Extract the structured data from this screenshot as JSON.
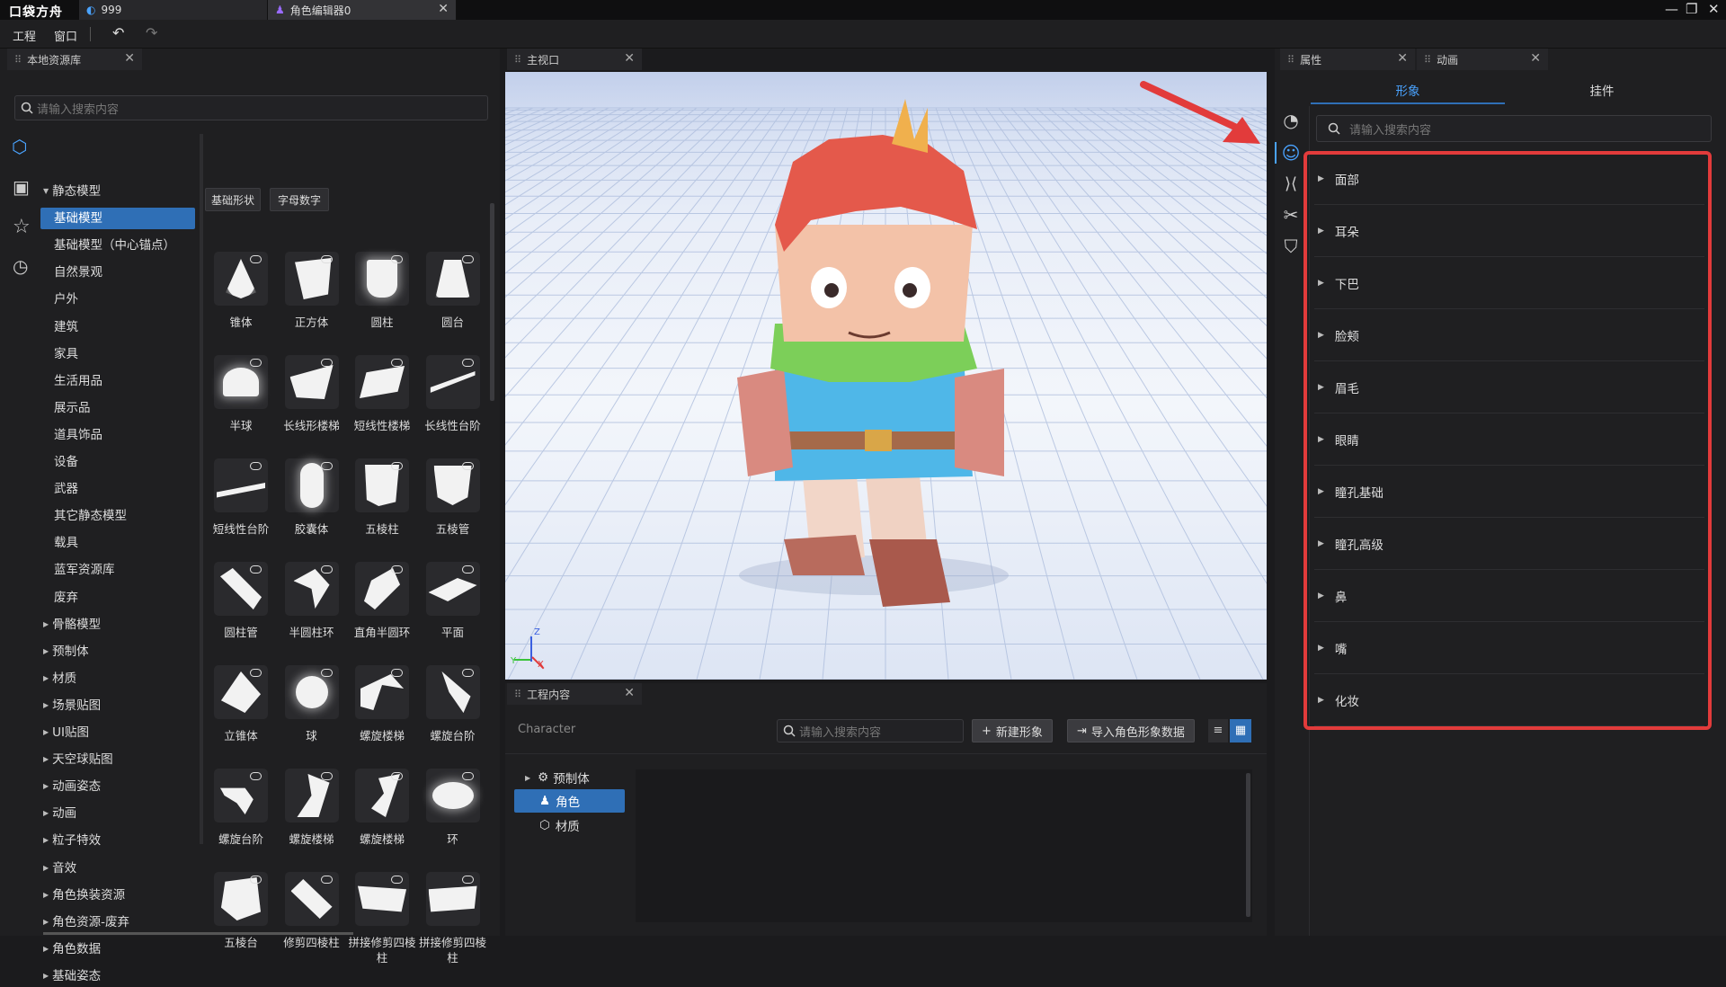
{
  "app": {
    "logo": "口袋方舟"
  },
  "tabs": [
    {
      "label": "999"
    },
    {
      "label": "角色编辑器0"
    }
  ],
  "menu": {
    "project": "工程",
    "window": "窗口"
  },
  "left_panel": {
    "tab_label": "本地资源库",
    "search_placeholder": "请输入搜索内容",
    "categories": [
      {
        "label": "静态模型",
        "expanded": true
      },
      {
        "label": "基础模型",
        "selected": true
      },
      {
        "label": "基础模型（中心锚点）"
      },
      {
        "label": "自然景观"
      },
      {
        "label": "户外"
      },
      {
        "label": "建筑"
      },
      {
        "label": "家具"
      },
      {
        "label": "生活用品"
      },
      {
        "label": "展示品"
      },
      {
        "label": "道具饰品"
      },
      {
        "label": "设备"
      },
      {
        "label": "武器"
      },
      {
        "label": "其它静态模型"
      },
      {
        "label": "载具"
      },
      {
        "label": "蓝军资源库"
      },
      {
        "label": "废弃"
      },
      {
        "label": "骨骼模型"
      },
      {
        "label": "预制体"
      },
      {
        "label": "材质"
      },
      {
        "label": "场景贴图"
      },
      {
        "label": "UI贴图"
      },
      {
        "label": "天空球贴图"
      },
      {
        "label": "动画姿态"
      },
      {
        "label": "动画"
      },
      {
        "label": "粒子特效"
      },
      {
        "label": "音效"
      },
      {
        "label": "角色换装资源"
      },
      {
        "label": "角色资源-废弃"
      },
      {
        "label": "角色数据"
      },
      {
        "label": "基础姿态"
      }
    ],
    "chips": [
      "基础形状",
      "字母数字"
    ],
    "assets": [
      {
        "label": "锥体",
        "icon": "cone-shape"
      },
      {
        "label": "正方体",
        "icon": "cube-shape"
      },
      {
        "label": "圆柱",
        "icon": "cylinder-shape"
      },
      {
        "label": "圆台",
        "icon": "frustum-shape"
      },
      {
        "label": "半球",
        "icon": "hemisphere-shape"
      },
      {
        "label": "长线形楼梯",
        "icon": "long-stairs-shape"
      },
      {
        "label": "短线性楼梯",
        "icon": "short-stairs-shape"
      },
      {
        "label": "长线性台阶",
        "icon": "long-step-shape"
      },
      {
        "label": "短线性台阶",
        "icon": "short-step-shape"
      },
      {
        "label": "胶囊体",
        "icon": "capsule-shape"
      },
      {
        "label": "五棱柱",
        "icon": "pentagonal-prism-shape"
      },
      {
        "label": "五棱管",
        "icon": "pentagonal-tube-shape"
      },
      {
        "label": "圆柱管",
        "icon": "cylinder-tube-shape"
      },
      {
        "label": "半圆柱环",
        "icon": "half-ring-shape"
      },
      {
        "label": "直角半圆环",
        "icon": "right-angle-ring-shape"
      },
      {
        "label": "平面",
        "icon": "plane-shape"
      },
      {
        "label": "立锥体",
        "icon": "pyramid-shape"
      },
      {
        "label": "球",
        "icon": "sphere-shape"
      },
      {
        "label": "螺旋楼梯",
        "icon": "spiral-stairs-shape"
      },
      {
        "label": "螺旋台阶",
        "icon": "spiral-step-shape"
      },
      {
        "label": "螺旋台阶",
        "icon": "spiral-step2-shape"
      },
      {
        "label": "螺旋楼梯",
        "icon": "spiral-stairs2-shape"
      },
      {
        "label": "螺旋楼梯",
        "icon": "spiral-stairs3-shape"
      },
      {
        "label": "环",
        "icon": "torus-shape"
      },
      {
        "label": "五棱台",
        "icon": "pentagonal-frustum-shape"
      },
      {
        "label": "修剪四棱柱",
        "icon": "trimmed-prism-shape"
      },
      {
        "label": "拼接修剪四棱柱",
        "icon": "joined-prism-shape"
      },
      {
        "label": "拼接修剪四棱柱",
        "icon": "joined-prism2-shape"
      }
    ]
  },
  "viewport": {
    "tab_label": "主视口",
    "axis_x": "X",
    "axis_y": "Y",
    "axis_z": "Z"
  },
  "project_panel": {
    "tab_label": "工程内容",
    "name": "Character",
    "search_placeholder": "请输入搜索内容",
    "new_button": "新建形象",
    "import_button": "导入角色形象数据",
    "tree": [
      {
        "label": "预制体",
        "icon": "prefab-icon"
      },
      {
        "label": "角色",
        "icon": "character-icon",
        "selected": true
      },
      {
        "label": "材质",
        "icon": "material-icon"
      }
    ]
  },
  "right_panel": {
    "tab_props": "属性",
    "tab_anim": "动画",
    "subtab_appearance": "形象",
    "subtab_attach": "挂件",
    "search_placeholder": "请输入搜索内容",
    "sections": [
      "面部",
      "耳朵",
      "下巴",
      "脸颊",
      "眉毛",
      "眼睛",
      "瞳孔基础",
      "瞳孔高级",
      "鼻",
      "嘴",
      "化妆"
    ]
  },
  "colors": {
    "accent": "#2f6fb6",
    "highlight_red": "#e23b3b",
    "sky": "#c9d6f0"
  }
}
